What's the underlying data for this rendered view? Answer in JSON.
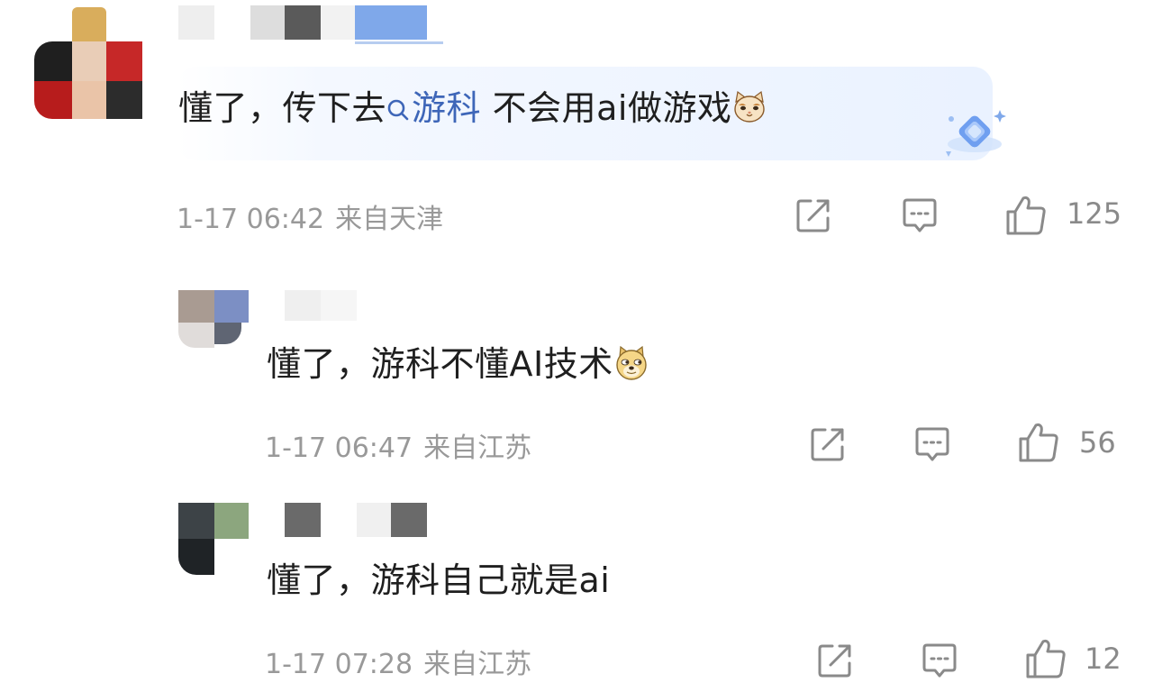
{
  "comments": [
    {
      "text_prefix": "懂了，传下去",
      "topic": "游科",
      "text_suffix": " 不会用ai做游戏",
      "emoji": "cat-emoji",
      "time": "1-17 06:42",
      "location": "来自天津",
      "likes": "125",
      "highlighted": true
    },
    {
      "text": "懂了，游科不懂AI技术",
      "emoji": "doge-emoji",
      "time": "1-17 06:47",
      "location": "来自江苏",
      "likes": "56"
    },
    {
      "text": "懂了，游科自己就是ai",
      "time": "1-17 07:28",
      "location": "来自江苏",
      "likes": "12"
    }
  ],
  "icons": {
    "share": "share-icon",
    "reply": "comment-icon",
    "like": "thumbs-up-icon",
    "topic_search": "search-icon",
    "badge": "diamond-badge-icon"
  },
  "colors": {
    "topic_link": "#3e66b8",
    "meta_text": "#999999",
    "icon_stroke": "#8a8a8a",
    "highlight": "#eaf2ff"
  }
}
